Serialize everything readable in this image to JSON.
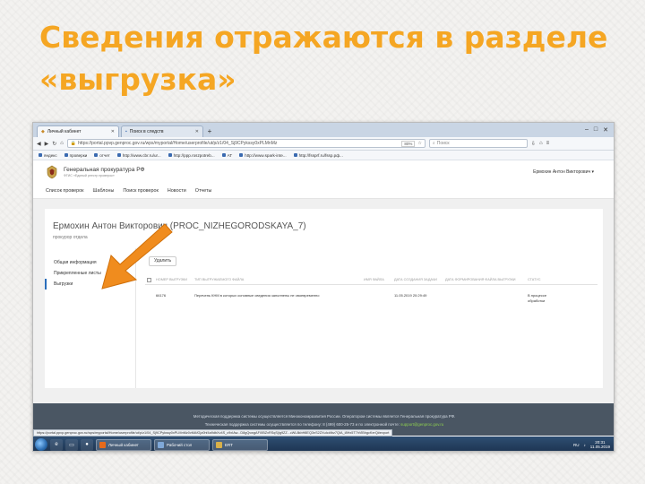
{
  "slide": {
    "title": "Сведения отражаются в разделе «выгрузка»"
  },
  "browser": {
    "tabs": [
      {
        "label": "Личный кабинет",
        "active": true
      },
      {
        "label": "Поиск в следств",
        "active": false
      }
    ],
    "new_tab": "+",
    "window_controls": [
      "–",
      "□",
      "✕"
    ],
    "nav_icons": [
      "back-icon",
      "forward-icon",
      "refresh-icon",
      "home-icon"
    ],
    "url": "https://portal.ppvp.genproc.gov.ru/wps/myportal/Home/userprofile/ut/p/z1/04_Sj9CPykssy0xPLMnMz",
    "zoom": "80%",
    "search_placeholder": "Поиск",
    "bookmarks": [
      "яндекс",
      "проверки",
      "отчет",
      "http://www.cbr.ru/ur...",
      "http://ppp.roszpotreb...",
      "AT",
      "http://www.spark-inte...",
      "http://fssprf.ru/fssp.рф..."
    ]
  },
  "site": {
    "org_name": "Генеральная прокуратура РФ",
    "org_sub": "ФГИС «Единый реестр проверок»",
    "user_menu": "Ермохин Антон Викторович ▾",
    "nav": [
      "Список проверок",
      "Шаблоны",
      "Поиск проверок",
      "Новости",
      "Отчеты"
    ],
    "person_name": "Ермохин Антон Викторович (PROC_NIZHEGORODSKAYA_7)",
    "person_role": "прокурор отдела",
    "left_menu": [
      {
        "label": "Общая информация",
        "selected": false
      },
      {
        "label": "Прикрепленные листы",
        "selected": false
      },
      {
        "label": "Выгрузки",
        "selected": true
      }
    ],
    "delete_button": "Удалить",
    "table": {
      "headers": [
        "НОМЕР ВЫГРУЗКИ",
        "ТИП ВЫГРУЖАЕМОГО ФАЙЛА",
        "ИМЯ ФАЙЛА",
        "ДАТА СОЗДАНИЯ ЗАДАЧИ",
        "ДАТА ФОРМИРОВАНИЯ ФАЙЛА ВЫГРУЗКИ",
        "СТАТУС"
      ],
      "rows": [
        {
          "number": "66176",
          "type": "Перечень КНМ в которых основные сведения заполнены не своевременно",
          "filename": "",
          "created": "11.05.2019 20:29:49",
          "formed": "",
          "status": "В процессе обработки"
        }
      ]
    },
    "footer_line1": "Методическая поддержка системы осуществляется Минэкономразвития России. Оператором системы является Генеральная прокуратура РФ.",
    "footer_line2": "Техническая поддержка системы осуществляется по телефону: 8 (499) 600-25-73 и по электронной почте:",
    "footer_email": "support@genproc.gov.ru"
  },
  "status_url": "https://portal.ppvp.genproc.gov.ru/wps/myportal/Home/userprofile/ut/p/z1/04_Sj9CPykssy0xPLMnMz0vMAfGjz0hf4a9dbXv4S_c9xIAw...D8gQvwgAFiXBZxRSqSjIg9ZZ...cWL8kbH8EQ3nS2ZXuIc#Ibz7QIA_i8Hx5T7hVlBhgcKerQ#export",
  "taskbar": {
    "items": [
      "Личный кабинет",
      "Рабочий стол",
      "ERT"
    ],
    "lang": "RU",
    "time": "20:31",
    "date": "11.05.2019"
  },
  "colors": {
    "title": "#f5a623",
    "arrow": "#f08c1e",
    "footer_bg": "#4a5663",
    "accent": "#2a6ebb"
  }
}
